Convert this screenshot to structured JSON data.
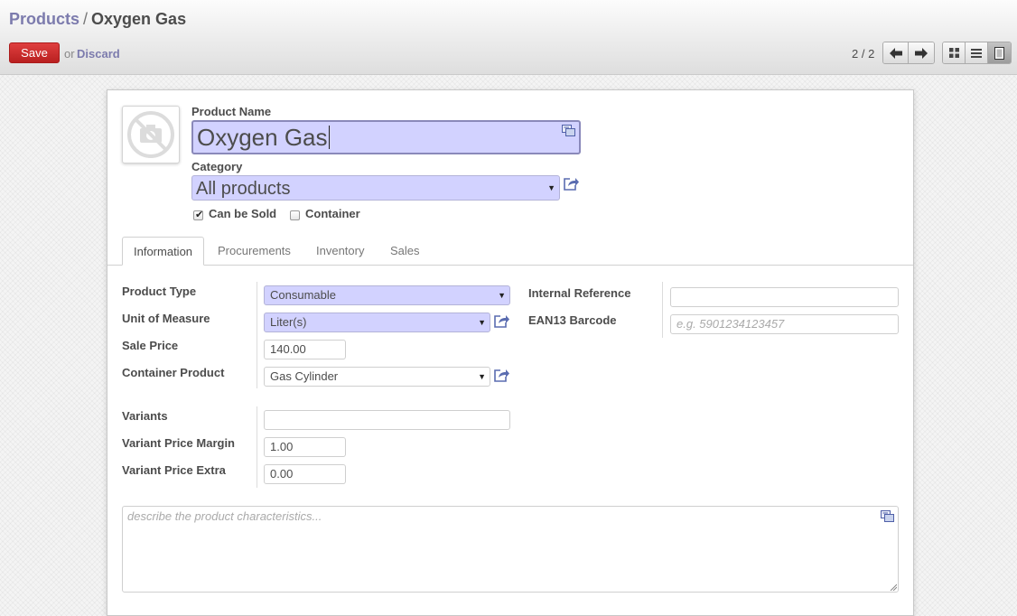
{
  "breadcrumb": {
    "parent": "Products",
    "separator": "/",
    "current": "Oxygen Gas"
  },
  "actions": {
    "save_label": "Save",
    "or_text": "or",
    "discard_label": "Discard"
  },
  "pager": {
    "value": "2 / 2"
  },
  "icons": {
    "image_placeholder": "no-camera-icon",
    "translate": "translate-icon",
    "external_link": "external-link-icon",
    "pager_prev": "arrow-left-icon",
    "pager_next": "arrow-right-icon",
    "view_kanban": "grid-icon",
    "view_list": "list-icon",
    "view_form": "form-icon"
  },
  "colors": {
    "accent": "#7c7bad",
    "save": "#c62a2a",
    "required_field": "#d2d2ff"
  },
  "form": {
    "product_name_label": "Product Name",
    "product_name_value": "Oxygen Gas",
    "category_label": "Category",
    "category_value": "All products",
    "can_be_sold_label": "Can be Sold",
    "can_be_sold_checked": true,
    "container_label": "Container",
    "container_checked": false
  },
  "tabs": [
    {
      "label": "Information",
      "active": true
    },
    {
      "label": "Procurements",
      "active": false
    },
    {
      "label": "Inventory",
      "active": false
    },
    {
      "label": "Sales",
      "active": false
    }
  ],
  "info": {
    "product_type_label": "Product Type",
    "product_type_value": "Consumable",
    "uom_label": "Unit of Measure",
    "uom_value": "Liter(s)",
    "sale_price_label": "Sale Price",
    "sale_price_value": "140.00",
    "container_product_label": "Container Product",
    "container_product_value": "Gas Cylinder",
    "variants_label": "Variants",
    "variants_value": "",
    "variant_price_margin_label": "Variant Price Margin",
    "variant_price_margin_value": "1.00",
    "variant_price_extra_label": "Variant Price Extra",
    "variant_price_extra_value": "0.00",
    "internal_reference_label": "Internal Reference",
    "internal_reference_value": "",
    "ean13_label": "EAN13 Barcode",
    "ean13_placeholder": "e.g. 5901234123457",
    "description_placeholder": "describe the product characteristics..."
  }
}
